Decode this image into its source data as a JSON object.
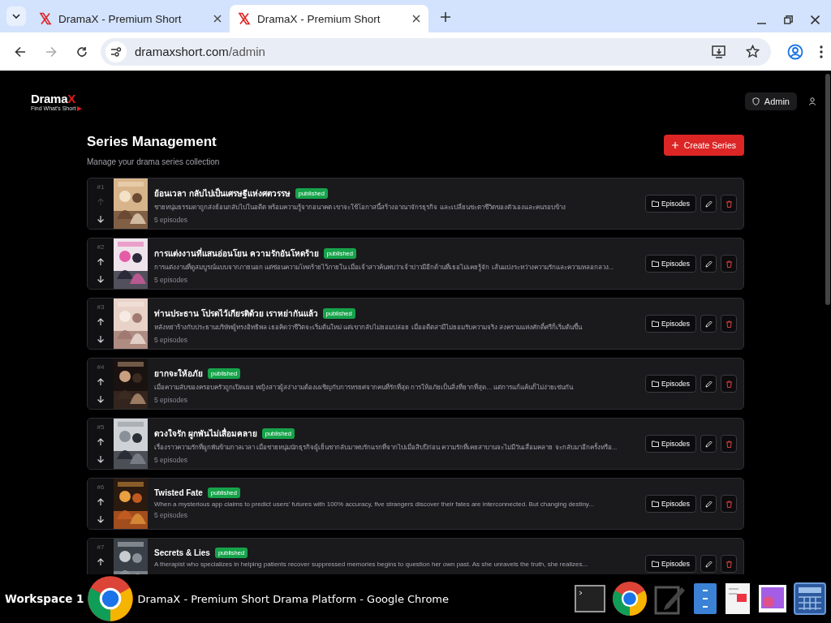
{
  "browser": {
    "tabs": [
      {
        "title": "DramaX - Premium Short",
        "selected": false
      },
      {
        "title": "DramaX - Premium Short",
        "selected": true
      }
    ],
    "address": {
      "host": "dramaxshort.com",
      "path": "/admin"
    }
  },
  "header": {
    "logo": {
      "text": "Drama",
      "accent": "X",
      "tagline": "Find What's Short"
    },
    "role_badge": "Admin"
  },
  "page": {
    "title": "Series Management",
    "subtitle": "Manage your drama series collection",
    "create_button": "Create Series"
  },
  "series": [
    {
      "rank": "#1",
      "title": "ย้อนเวลา กลับไปเป็นเศรษฐีแห่งศตวรรษ",
      "status": "published",
      "description": "ชายหนุ่มธรรมดาถูกส่งย้อนกลับไปในอดีต พร้อมความรู้จากอนาคต เขาจะใช้โอกาสนี้สร้างอาณาจักรธุรกิจ และเปลี่ยนชะตาชีวิตของตัวเองและคนรอบข้าง",
      "episodes": "5 episodes",
      "up_disabled": true,
      "action": "Episodes"
    },
    {
      "rank": "#2",
      "title": "การแต่งงานที่แสนอ่อนโยน ความรักอันโหดร้าย",
      "status": "published",
      "description": "การแต่งงานที่ดูสมบูรณ์แบบจากภายนอก แต่ซ่อนความโหดร้ายไว้ภายใน เมื่อเจ้าสาวค้นพบว่าเจ้าบ่าวมีอีกด้านที่เธอไม่เคยรู้จัก เส้นแบ่งระหว่างความรักและความหลอกลวง...",
      "episodes": "5 episodes",
      "up_disabled": false,
      "action": "Episodes"
    },
    {
      "rank": "#3",
      "title": "ท่านประธาน โปรดไว้เกียรติด้วย เราหย่ากันแล้ว",
      "status": "published",
      "description": "หลังหย่าร้างกับประธานบริษัทผู้ทรงอิทธิพล เธอคิดว่าชีวิตจะเริ่มต้นใหม่ แต่เขากลับไม่ยอมปล่อย เมื่ออดีตสามีไม่ยอมรับความจริง สงครามแห่งศักดิ์ศรีก็เริ่มต้นขึ้น",
      "episodes": "5 episodes",
      "up_disabled": false,
      "action": "Episodes"
    },
    {
      "rank": "#4",
      "title": "ยากจะให้อภัย",
      "status": "published",
      "description": "เมื่อความลับของครอบครัวถูกเปิดเผย หญิงสาวผู้สง่างามต้องเผชิญกับการหรยศจากคนที่รักที่สุด การให้อภัยเป็นสิ่งที่ยากที่สุด... แต่การแก้แค้นก็ไม่ง่ายเช่นกัน",
      "episodes": "5 episodes",
      "up_disabled": false,
      "action": "Episodes"
    },
    {
      "rank": "#5",
      "title": "ดวงใจรัก ผูกพันไม่เสื่อมคลาย",
      "status": "published",
      "description": "เรื่องราวความรักที่ผูกพันข้ามกาลเวลา เมื่อชายหนุ่มนักธุรกิจผู้เย็นชากลับมาพบรักแรกที่จากไปเมื่อสิบปีก่อน ความรักที่เคยสาบานจะไม่มีวันเสื่อมคลาย จะกลับมาอีกครั้งหรือ...",
      "episodes": "5 episodes",
      "up_disabled": false,
      "action": "Episodes"
    },
    {
      "rank": "#6",
      "title": "Twisted Fate",
      "status": "published",
      "description": "When a mysterious app claims to predict users' futures with 100% accuracy, five strangers discover their fates are interconnected. But changing destiny...",
      "episodes": "5 episodes",
      "up_disabled": false,
      "action": "Episodes"
    },
    {
      "rank": "#7",
      "title": "Secrets & Lies",
      "status": "published",
      "description": "A therapist who specializes in helping patients recover suppressed memories begins to question her own past. As she unravels the truth, she realizes...",
      "up_disabled": false,
      "action": "Episodes"
    }
  ],
  "taskbar": {
    "workspace": "Workspace 1",
    "window_title": "DramaX - Premium Short Drama Platform - Google Chrome"
  }
}
